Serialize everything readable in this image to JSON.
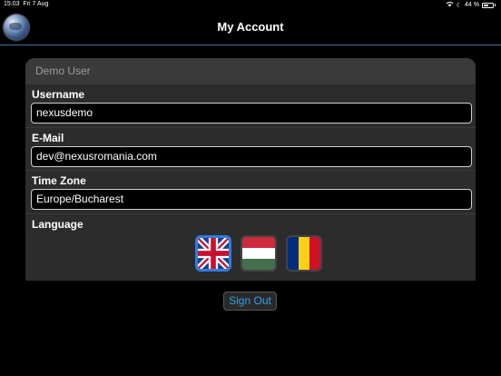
{
  "status_bar": {
    "time": "15:03",
    "date": "Fri 7 Aug",
    "battery": "44 %"
  },
  "nav": {
    "title": "My Account"
  },
  "card": {
    "header": "Demo User",
    "username_label": "Username",
    "username_value": "nexusdemo",
    "email_label": "E-Mail",
    "email_value": "dev@nexusromania.com",
    "timezone_label": "Time Zone",
    "timezone_value": "Europe/Bucharest",
    "language_label": "Language",
    "languages": [
      {
        "name": "uk-flag-icon",
        "selected": true
      },
      {
        "name": "hungary-flag-icon",
        "selected": false
      },
      {
        "name": "romania-flag-icon",
        "selected": false
      }
    ]
  },
  "signout_label": "Sign Out",
  "colors": {
    "accent": "#2f7de0",
    "link": "#38a0e8",
    "navbar_border": "#4a6fa0"
  }
}
